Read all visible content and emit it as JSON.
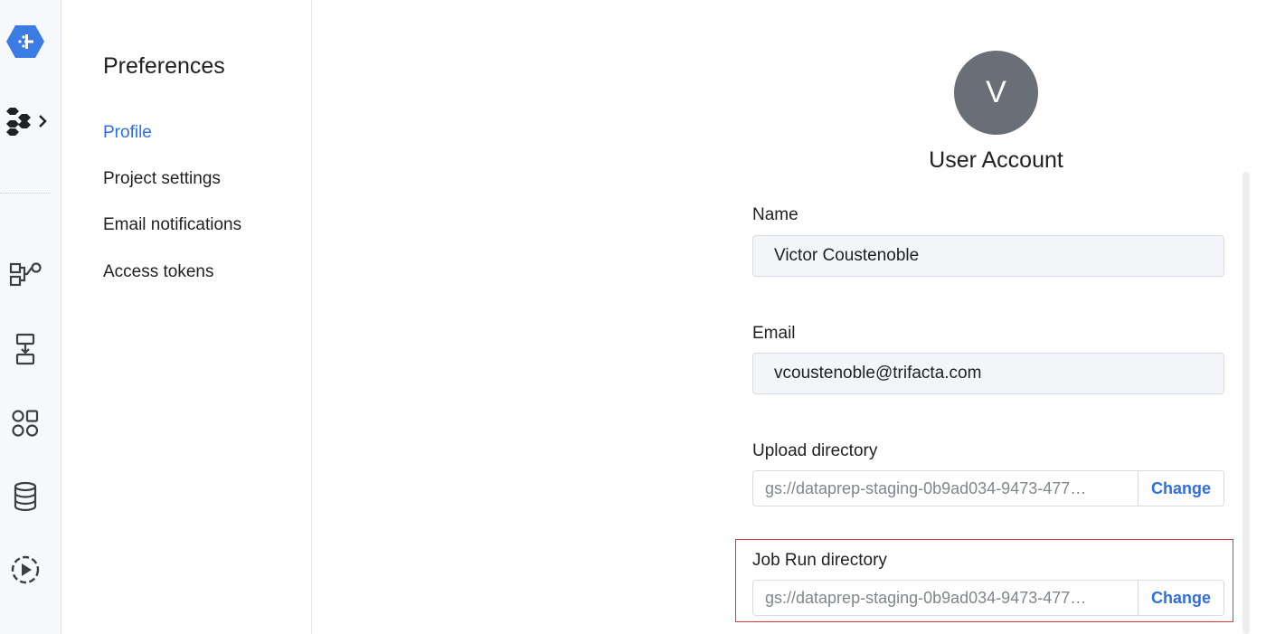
{
  "rail": {
    "icons": [
      "dataprep-logo-icon",
      "apps-switcher-icon",
      "flows-icon",
      "plans-icon",
      "library-icon",
      "connections-icon",
      "jobs-icon"
    ]
  },
  "preferences": {
    "title": "Preferences",
    "nav": [
      {
        "label": "Profile",
        "active": true
      },
      {
        "label": "Project settings",
        "active": false
      },
      {
        "label": "Email notifications",
        "active": false
      },
      {
        "label": "Access tokens",
        "active": false
      }
    ]
  },
  "account": {
    "avatar_initial": "V",
    "title": "User Account",
    "name_label": "Name",
    "name_value": "Victor Coustenoble",
    "email_label": "Email",
    "email_value": "vcoustenoble@trifacta.com",
    "upload_label": "Upload directory",
    "upload_value": "gs://dataprep-staging-0b9ad034-9473-477…",
    "upload_button": "Change",
    "jobrun_label": "Job Run directory",
    "jobrun_value": "gs://dataprep-staging-0b9ad034-9473-477…",
    "jobrun_button": "Change"
  },
  "colors": {
    "accent": "#2f6fde",
    "logo": "#3b7ce4",
    "highlight": "#e0393e",
    "avatar": "#6a6f77"
  }
}
